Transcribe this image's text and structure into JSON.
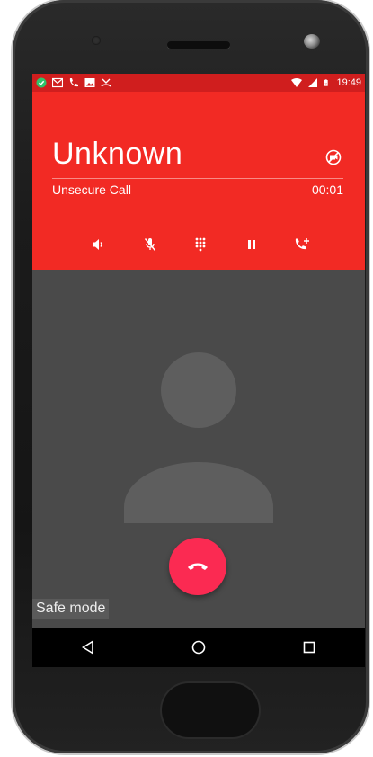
{
  "status_bar": {
    "time": "19:49",
    "icons_left": [
      "shield-check-icon",
      "gmail-icon",
      "phone-icon",
      "image-icon",
      "missed-call-icon"
    ],
    "icons_right": [
      "wifi-icon",
      "signal-icon",
      "battery-icon"
    ]
  },
  "call": {
    "caller_name": "Unknown",
    "security_status": "Unsecure Call",
    "timer": "00:01",
    "controls": [
      "speaker-icon",
      "mute-icon",
      "dialpad-icon",
      "hold-icon",
      "add-call-icon"
    ]
  },
  "safe_mode_label": "Safe mode",
  "colors": {
    "header_red": "#f22a24",
    "status_red": "#d01e1e",
    "end_call_pink": "#fb2a52",
    "background_gray": "#4a4a4a"
  }
}
